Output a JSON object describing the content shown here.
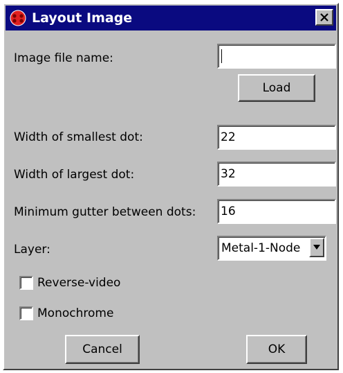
{
  "window": {
    "title": "Layout Image",
    "close_glyph": "×",
    "title_icon": "app-icon",
    "close_icon": "close-icon"
  },
  "fields": {
    "image_file_label": "Image file name:",
    "image_file_value": "",
    "smallest_dot_label": "Width of smallest dot:",
    "smallest_dot_value": "22",
    "largest_dot_label": "Width of largest dot:",
    "largest_dot_value": "32",
    "gutter_label": "Minimum gutter between dots:",
    "gutter_value": "16",
    "layer_label": "Layer:",
    "layer_selected": "Metal-1-Node"
  },
  "checkboxes": {
    "reverse_video_label": "Reverse-video",
    "reverse_video_checked": false,
    "monochrome_label": "Monochrome",
    "monochrome_checked": false
  },
  "buttons": {
    "load": "Load",
    "cancel": "Cancel",
    "ok": "OK"
  },
  "colors": {
    "titlebar": "#0a0a80",
    "dialog_face": "#c0c0c0",
    "icon_red": "#e02020"
  }
}
